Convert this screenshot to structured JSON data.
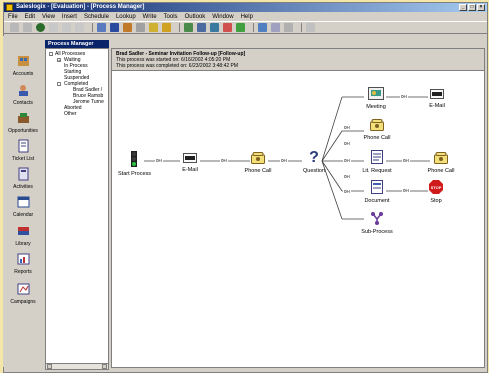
{
  "window": {
    "title": "Saleslogix - [Evaluation] - [Process Manager]"
  },
  "menu": [
    "File",
    "Edit",
    "View",
    "Insert",
    "Schedule",
    "Lookup",
    "Write",
    "Tools",
    "Outlook",
    "Window",
    "Help"
  ],
  "toolbar_icons": [
    "back-icon",
    "forward-icon",
    "home-icon",
    "save-icon",
    "stop-icon",
    "refresh-icon",
    "sep",
    "contact-icon",
    "calendar-icon",
    "phone-icon",
    "email-icon",
    "notes-icon",
    "opportunity-icon",
    "sep",
    "find-icon",
    "print-icon",
    "help-icon"
  ],
  "outlook_bar": [
    {
      "label": "Accounts",
      "icon": "accounts-icon"
    },
    {
      "label": "Contacts",
      "icon": "contacts-icon"
    },
    {
      "label": "Opportunities",
      "icon": "opportunities-icon"
    },
    {
      "label": "Ticket List",
      "icon": "ticket-list-icon"
    },
    {
      "label": "Activities",
      "icon": "activities-icon"
    },
    {
      "label": "Calendar",
      "icon": "calendar-icon"
    },
    {
      "label": "Library",
      "icon": "library-icon"
    },
    {
      "label": "Reports",
      "icon": "reports-icon"
    },
    {
      "label": "Campaigns",
      "icon": "campaigns-icon"
    }
  ],
  "process_manager": {
    "header": "Process Manager",
    "tree": [
      {
        "label": "All Processes",
        "indent": 0,
        "expander": "-"
      },
      {
        "label": "Waiting",
        "indent": 1,
        "expander": "+"
      },
      {
        "label": "In Process",
        "indent": 1,
        "expander": ""
      },
      {
        "label": "Starting",
        "indent": 1,
        "expander": ""
      },
      {
        "label": "Suspended",
        "indent": 1,
        "expander": ""
      },
      {
        "label": "Completed",
        "indent": 1,
        "expander": "-"
      },
      {
        "label": "Brad Sadler /",
        "indent": 2,
        "expander": ""
      },
      {
        "label": "Bruce Ramsb",
        "indent": 2,
        "expander": ""
      },
      {
        "label": "Jerome Turne",
        "indent": 2,
        "expander": ""
      },
      {
        "label": "Aborted",
        "indent": 1,
        "expander": ""
      },
      {
        "label": "Other",
        "indent": 1,
        "expander": ""
      }
    ]
  },
  "process_info": {
    "title": "Brad Sadler - Seminar Invitation Follow-up [Follow-up]",
    "started": "This process was started on: 6/16/2002 4:05:20 PM",
    "completed": "This process was completed on: 6/23/2002 3:48:42 PM"
  },
  "flow": {
    "nodes": {
      "start": {
        "label": "Start Process",
        "icon": "traffic-light-icon"
      },
      "email1": {
        "label": "E-Mail",
        "icon": "email-icon"
      },
      "phone1": {
        "label": "Phone Call",
        "icon": "phone-icon"
      },
      "question": {
        "label": "Question",
        "icon": "question-icon"
      },
      "meeting": {
        "label": "Meeting",
        "icon": "meeting-icon"
      },
      "email2": {
        "label": "E-Mail",
        "icon": "email-icon"
      },
      "phone2": {
        "label": "Phone Call",
        "icon": "phone-icon"
      },
      "litreq": {
        "label": "Lit. Request",
        "icon": "literature-icon"
      },
      "phone3": {
        "label": "Phone Call",
        "icon": "phone-icon"
      },
      "document": {
        "label": "Document",
        "icon": "document-icon"
      },
      "stop": {
        "label": "Stop",
        "icon": "stop-sign-icon"
      },
      "subprocess": {
        "label": "Sub-Process",
        "icon": "sub-process-icon"
      }
    },
    "edge_labels": {
      "e1": "0H",
      "e2": "0H",
      "e3": "0H",
      "q1": "0H",
      "q2": "0H",
      "q3": "0H",
      "q4": "0H",
      "q5": "0H",
      "m1": "0H",
      "l1": "0H",
      "d1": "0H"
    }
  },
  "colors": {
    "title_start": "#0a246a",
    "title_end": "#a6caf0",
    "phone_yellow": "#f2e07a",
    "stop_red": "#d11a1a",
    "accent_purple": "#6a3a9a",
    "outer_background": "#f4e6a8"
  }
}
